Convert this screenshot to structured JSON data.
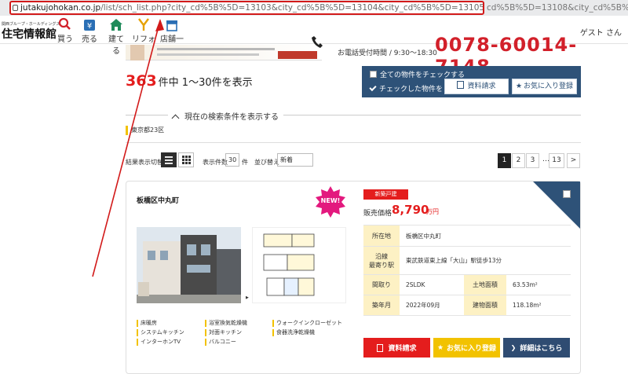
{
  "browser": {
    "url_host": "jutakujohokan.co.jp",
    "url_path": "/list/sch_list.php?city_cd%5B%5D=13103&city_cd%5B%5D=13104&city_cd%5B%5D=13105&city_cd%5B%5D=13106&city_cd%5B%5D=13107&city",
    "url_tail": "cd%5B%5D=13108&city_cd%5B%5D=13109..."
  },
  "header": {
    "logo_sub": "関西ブループ・ホールディングス",
    "logo_main": "住宅情報館",
    "nav": [
      {
        "label": "買う",
        "icon": "search-house-icon"
      },
      {
        "label": "売る",
        "icon": "yen-house-icon"
      },
      {
        "label": "建てる",
        "icon": "build-house-icon"
      },
      {
        "label": "リフォーム",
        "icon": "reform-icon"
      },
      {
        "label": "店舗一覧",
        "icon": "store-icon"
      }
    ],
    "guest": "ゲスト さん",
    "phone_hours": "お電話受付時間 / 9:30〜18:30",
    "phone_number": "0078-60014-7148"
  },
  "results": {
    "count": "363",
    "count_suffix": "件中 1〜30件を表示"
  },
  "bulk": {
    "check_all": "全ての物件をチェックする",
    "checked_label": "チェックした物件を",
    "request_button": "資料請求",
    "favorite_button": "お気に入り登録"
  },
  "conditions": {
    "toggle": "現在の検索条件を表示する",
    "area": "東京都23区"
  },
  "toolbar": {
    "view_label": "結果表示切替",
    "count_label": "表示件数",
    "count_value": "30",
    "count_unit": "件",
    "sort_label": "並び替え",
    "sort_value": "新着",
    "pages": [
      "1",
      "2",
      "3",
      "…",
      "13",
      ">"
    ]
  },
  "listing": {
    "title": "板橋区中丸町",
    "new_badge": "NEW!",
    "type_badge": "新築戸建",
    "price_label": "販売価格",
    "price_value": "8,790",
    "price_unit": "万円",
    "features": [
      "床暖房",
      "浴室換気乾燥機",
      "ウォークインクローゼット",
      "システムキッチン",
      "対面キッチン",
      "食器洗浄乾燥機",
      "インターホンTV",
      "バルコニー"
    ],
    "rows": {
      "location_label": "所在地",
      "location_value": "板橋区中丸町",
      "line_label": "沿線\n最寄り駅",
      "line_value": "東武鉄道東上線「大山」駅徒歩13分",
      "layout_label": "間取り",
      "layout_value": "2SLDK",
      "land_label": "土地面積",
      "land_value": "63.53m²",
      "built_label": "築年月",
      "built_value": "2022年09月",
      "building_label": "建物面積",
      "building_value": "118.18m²"
    },
    "btn_request": "資料請求",
    "btn_favorite": "お気に入り登録",
    "btn_detail": "詳細はこちら"
  },
  "colors": {
    "accent_red": "#e41d1d",
    "navy": "#2e5278",
    "yellow": "#f2c200",
    "label_bg": "#fdf1c4",
    "detail_btn": "#2f4c72"
  }
}
